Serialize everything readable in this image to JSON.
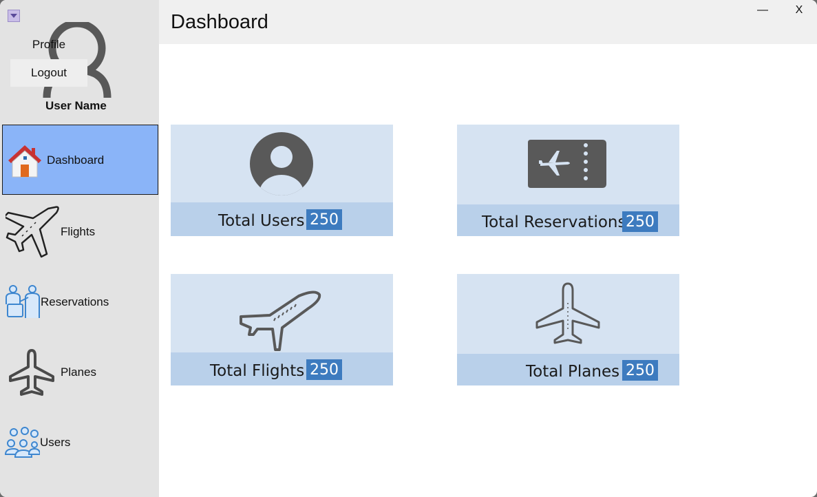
{
  "sidebar": {
    "menu": {
      "profile": "Profile",
      "logout": "Logout"
    },
    "user_name": "User Name",
    "nav": [
      {
        "label": "Dashboard",
        "icon": "house-icon",
        "active": true
      },
      {
        "label": "Flights",
        "icon": "airplane-icon"
      },
      {
        "label": "Reservations",
        "icon": "passengers-icon"
      },
      {
        "label": "Planes",
        "icon": "plane-topview-icon"
      },
      {
        "label": "Users",
        "icon": "users-group-icon"
      }
    ]
  },
  "header": {
    "title": "Dashboard",
    "minimize": "—",
    "close": "X"
  },
  "cards": [
    {
      "label": "Total Users",
      "count": "250",
      "icon": "user-avatar-icon"
    },
    {
      "label": "Total Reservations",
      "count": "250",
      "icon": "ticket-icon"
    },
    {
      "label": "Total Flights",
      "count": "250",
      "icon": "airplane-icon"
    },
    {
      "label": "Total Planes",
      "count": "250",
      "icon": "plane-topview-icon"
    }
  ],
  "colors": {
    "sidebar_bg": "#e3e3e3",
    "active_nav": "#8ab4f8",
    "card_bg": "#d6e3f2",
    "card_footer": "#b9d0ea",
    "count_badge": "#3d7bbf"
  }
}
